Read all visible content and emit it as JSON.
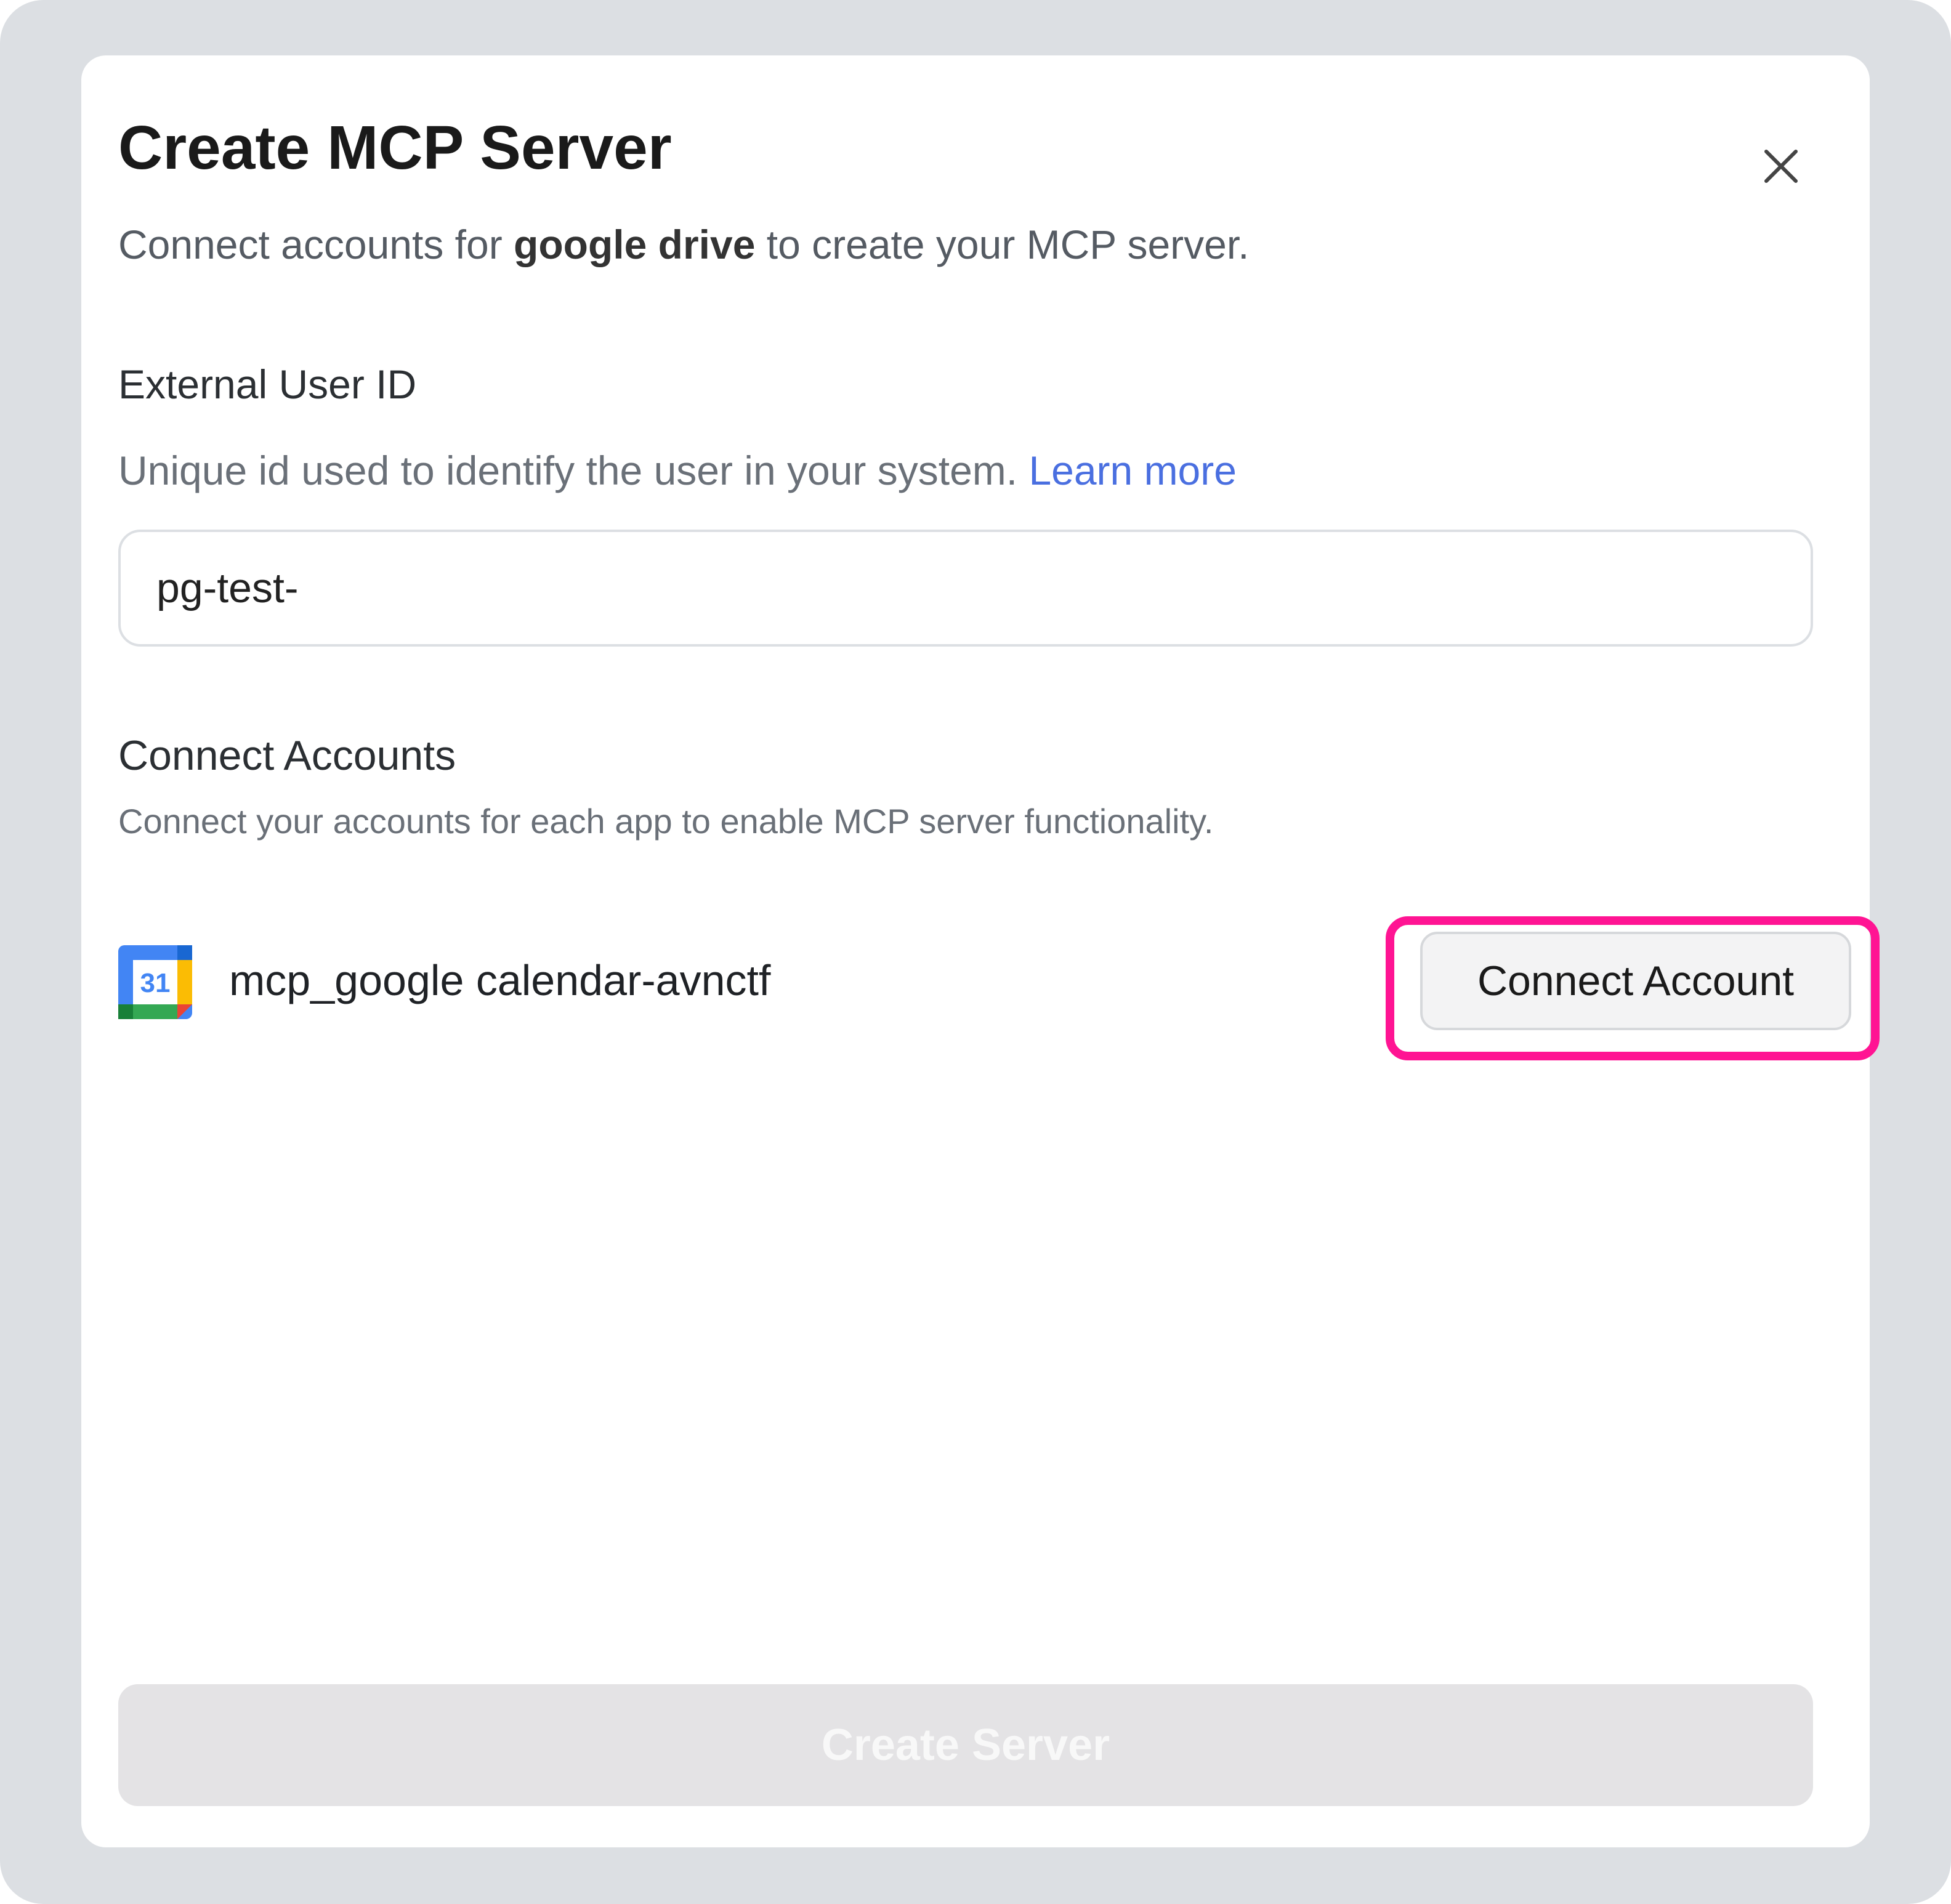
{
  "dialog": {
    "title": "Create MCP Server",
    "subtitle_prefix": "Connect accounts for ",
    "subtitle_bold": "google drive",
    "subtitle_suffix": " to create your MCP server."
  },
  "external_user": {
    "label": "External User ID",
    "help_text": "Unique id used to identify the user in your system. ",
    "learn_more": "Learn more",
    "value": "pg-test-"
  },
  "connect_accounts": {
    "title": "Connect Accounts",
    "description": "Connect your accounts for each app to enable MCP server functionality.",
    "apps": [
      {
        "name": "mcp_google calendar-avnctf",
        "icon": "google-calendar-icon",
        "icon_day": "31",
        "button_label": "Connect Account"
      }
    ]
  },
  "footer": {
    "create_label": "Create Server"
  },
  "colors": {
    "highlight": "#ff1493",
    "link": "#4a6fe0",
    "disabled_button": "#e4e3e5"
  }
}
